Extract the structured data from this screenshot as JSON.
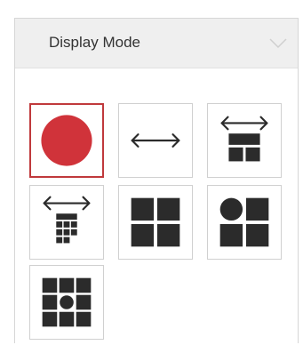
{
  "panel": {
    "title": "Display Mode",
    "expanded_icon": "chevron-down-icon"
  },
  "modes": [
    {
      "id": "mode-1",
      "icon": "single-circle-icon",
      "selected": true
    },
    {
      "id": "mode-2",
      "icon": "horizontal-arrow-icon",
      "selected": false
    },
    {
      "id": "mode-3",
      "icon": "arrow-grid-2x2-icon",
      "selected": false
    },
    {
      "id": "mode-4",
      "icon": "arrow-grid-dense-icon",
      "selected": false
    },
    {
      "id": "mode-5",
      "icon": "grid-2x2-icon",
      "selected": false
    },
    {
      "id": "mode-6",
      "icon": "circle-grid-2x2-icon",
      "selected": false
    },
    {
      "id": "mode-7",
      "icon": "grid-3x3-circle-center-icon",
      "selected": false
    }
  ],
  "colors": {
    "selected_border": "#c0393c",
    "circle_fill": "#d0333a",
    "icon_fill": "#2b2b2b"
  }
}
